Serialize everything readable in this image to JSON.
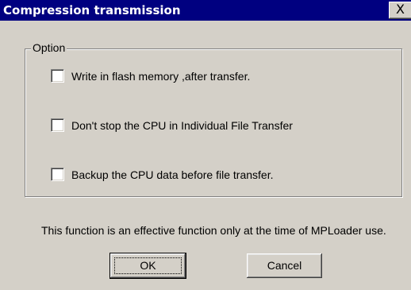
{
  "window": {
    "title": "Compression transmission",
    "close_glyph": "X"
  },
  "group": {
    "legend": "Option",
    "options": [
      {
        "label": "Write in flash memory ,after transfer.",
        "checked": false
      },
      {
        "label": "Don't stop the CPU in Individual File Transfer",
        "checked": false
      },
      {
        "label": "Backup the CPU data before file transfer.",
        "checked": false
      }
    ]
  },
  "note": "This function is an effective function only at the time of MPLoader use.",
  "buttons": {
    "ok_label": "OK",
    "cancel_label": "Cancel"
  },
  "colors": {
    "titlebar": "#000080",
    "face": "#d4d0c8"
  }
}
